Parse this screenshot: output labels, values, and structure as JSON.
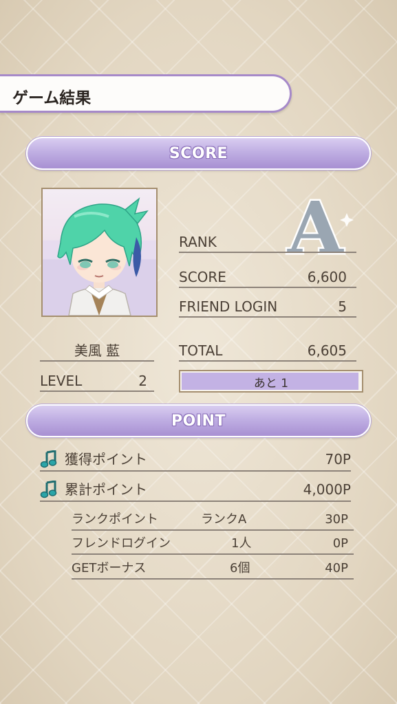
{
  "header": {
    "title": "ゲーム結果"
  },
  "score_section": {
    "title": "SCORE",
    "rank_label": "RANK",
    "rank_value": "A",
    "score_label": "SCORE",
    "score_value": "6,600",
    "friend_label": "FRIEND LOGIN",
    "friend_value": "5",
    "total_label": "TOTAL",
    "total_value": "6,605"
  },
  "character": {
    "name": "美風 藍",
    "level_label": "LEVEL",
    "level_value": "2",
    "exp_text": "あと 1",
    "exp_progress": 0.99
  },
  "point_section": {
    "title": "POINT",
    "earned_label": "獲得ポイント",
    "earned_value": "70P",
    "total_label": "累計ポイント",
    "total_value": "4,000P",
    "breakdown": [
      {
        "label": "ランクポイント",
        "detail": "ランクA",
        "value": "30P"
      },
      {
        "label": "フレンドログイン",
        "detail": "1人",
        "value": "0P"
      },
      {
        "label": "GETボーナス",
        "detail": "6個",
        "value": "40P"
      }
    ]
  },
  "icons": {
    "note_icon": "music-note-icon",
    "rank_badge": "rank-a-badge"
  },
  "colors": {
    "accent": "#a689c9",
    "header_fill": "#c0afe3",
    "note_color": "#2aa5a8"
  }
}
